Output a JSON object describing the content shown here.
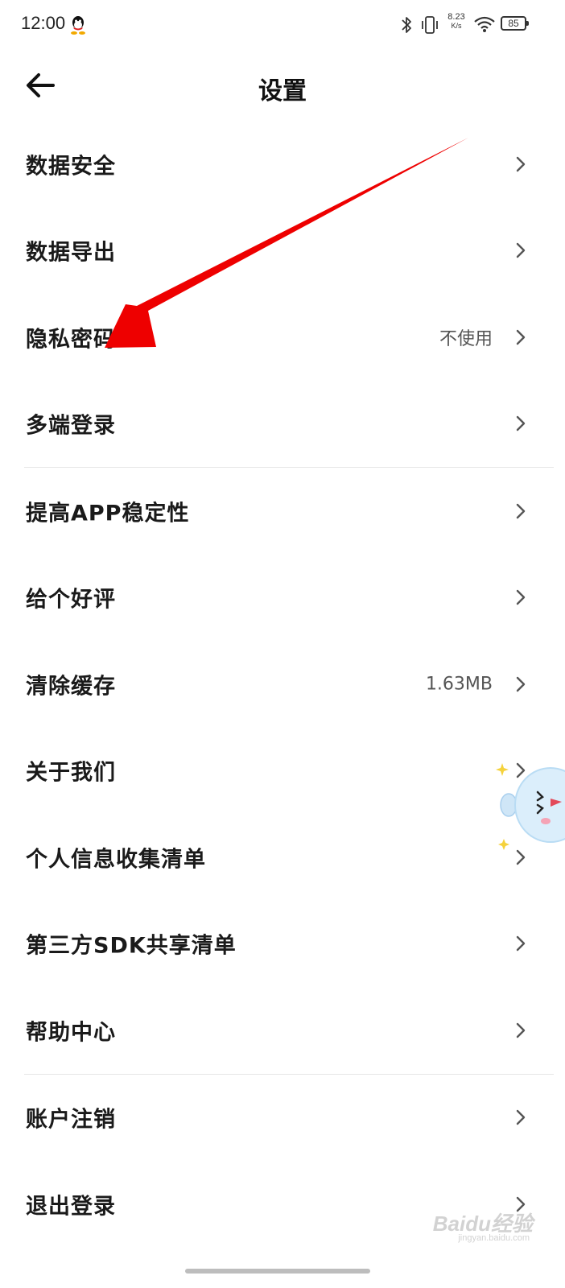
{
  "status_bar": {
    "time": "12:00",
    "net_speed_value": "8.23",
    "net_speed_unit": "K/s",
    "battery": "85",
    "icons": [
      "qq-icon",
      "bluetooth-icon",
      "vibrate-icon",
      "wifi-icon",
      "battery-icon"
    ]
  },
  "header": {
    "back_icon": "arrow-left-icon",
    "title": "设置"
  },
  "settings": {
    "items": [
      {
        "label": "数据安全",
        "value": ""
      },
      {
        "label": "数据导出",
        "value": ""
      },
      {
        "label": "隐私密码",
        "value": "不使用"
      },
      {
        "label": "多端登录",
        "value": ""
      },
      {
        "label": "提高APP稳定性",
        "value": ""
      },
      {
        "label": "给个好评",
        "value": ""
      },
      {
        "label": "清除缓存",
        "value": "1.63MB"
      },
      {
        "label": "关于我们",
        "value": ""
      },
      {
        "label": "个人信息收集清单",
        "value": ""
      },
      {
        "label": "第三方SDK共享清单",
        "value": ""
      },
      {
        "label": "帮助中心",
        "value": ""
      },
      {
        "label": "账户注销",
        "value": ""
      },
      {
        "label": "退出登录",
        "value": ""
      }
    ]
  },
  "watermark": {
    "text": "Baidu经验",
    "sub": "jingyan.baidu.com"
  },
  "colors": {
    "annotation_arrow": "#ee0000",
    "text_primary": "#1a1a1a",
    "text_secondary": "#555555",
    "divider": "#e6e6e6"
  }
}
